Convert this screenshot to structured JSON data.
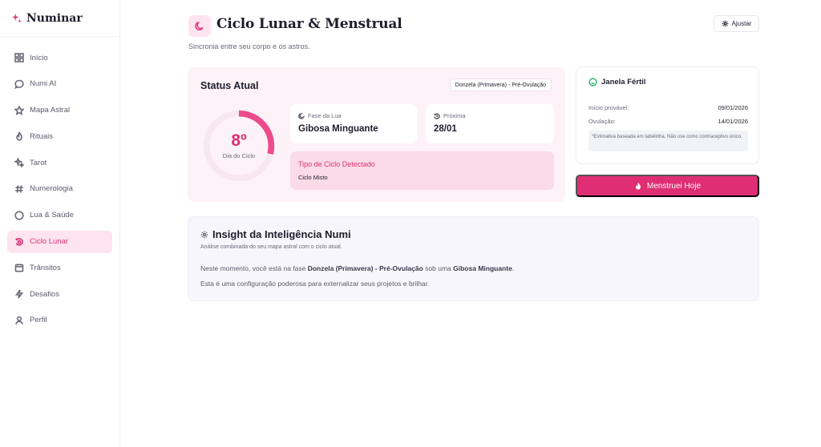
{
  "app": {
    "name": "Numinar",
    "brand_color": "#e23c84"
  },
  "sidebar": {
    "items": [
      {
        "label": "Início",
        "icon": "grid-icon",
        "active": false
      },
      {
        "label": "Numi AI",
        "icon": "chat-icon",
        "active": false
      },
      {
        "label": "Mapa Astral",
        "icon": "star-icon",
        "active": false
      },
      {
        "label": "Rituais",
        "icon": "flame-icon",
        "active": false
      },
      {
        "label": "Tarot",
        "icon": "sparkles-icon",
        "active": false
      },
      {
        "label": "Numerologia",
        "icon": "hash-icon",
        "active": false
      },
      {
        "label": "Lua & Saúde",
        "icon": "circle-icon",
        "active": false
      },
      {
        "label": "Ciclo Lunar",
        "icon": "cycle-icon",
        "active": true
      },
      {
        "label": "Trânsitos",
        "icon": "calendar-icon",
        "active": false
      },
      {
        "label": "Desafios",
        "icon": "bolt-icon",
        "active": false
      },
      {
        "label": "Perfil",
        "icon": "user-icon",
        "active": false
      }
    ]
  },
  "header": {
    "title": "Ciclo Lunar & Menstrual",
    "subtitle": "Sincronia entre seu corpo e os astros.",
    "adjust_label": "Ajustar"
  },
  "status": {
    "title": "Status Atual",
    "phase_badge": "Donzela (Primavera) - Pré-Ovulação",
    "cycle_day": "8º",
    "cycle_day_label": "Dia do Ciclo",
    "cycle_progress": 0.29,
    "moon_phase_label": "Fase da Lua",
    "moon_phase_value": "Gibosa Minguante",
    "next_label": "Próxima",
    "next_value": "28/01",
    "cycle_type_label": "Tipo de Ciclo Detectado",
    "cycle_type_value": "Ciclo Misto"
  },
  "fertile": {
    "title": "Janela Fértil",
    "start_label": "Início provável:",
    "start_value": "09/01/2026",
    "ovulation_label": "Ovulação:",
    "ovulation_value": "14/01/2026",
    "note": "*Estimativa baseada em tabelinha. Não use como contraceptivo único."
  },
  "actions": {
    "menstruei_label": "Menstruei Hoje"
  },
  "insight": {
    "title": "Insight da Inteligência Numi",
    "subtitle": "Análise combinada do seu mapa astral com o ciclo atual.",
    "line1_prefix": "Neste momento, você está na fase ",
    "line1_phase": "Donzela (Primavera) - Pré-Ovulação",
    "line1_middle": " sob uma ",
    "line1_moon": "Gibosa Minguante",
    "line1_suffix": ".",
    "line2": "Esta é uma configuração poderosa para externalizar seus projetos e brilhar."
  }
}
